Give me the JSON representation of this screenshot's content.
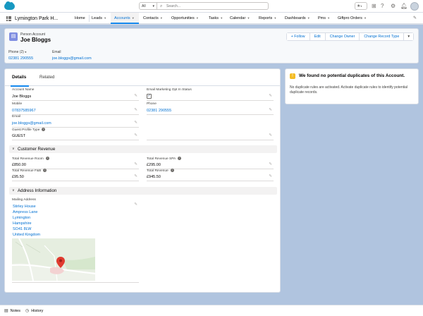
{
  "topbar": {
    "search_scope": "All",
    "search_placeholder": "Search..."
  },
  "nav": {
    "app_name": "Lymington Park H...",
    "items": [
      {
        "label": "Home",
        "dropdown": false
      },
      {
        "label": "Leads",
        "dropdown": true
      },
      {
        "label": "Accounts",
        "dropdown": true,
        "active": true
      },
      {
        "label": "Contacts",
        "dropdown": true
      },
      {
        "label": "Opportunities",
        "dropdown": true
      },
      {
        "label": "Tasks",
        "dropdown": true
      },
      {
        "label": "Calendar",
        "dropdown": true
      },
      {
        "label": "Reports",
        "dropdown": true
      },
      {
        "label": "Dashboards",
        "dropdown": true
      },
      {
        "label": "Pms",
        "dropdown": true
      },
      {
        "label": "Giftpro Orders",
        "dropdown": true
      }
    ]
  },
  "header": {
    "record_type": "Person Account",
    "record_name": "Joe Bloggs",
    "buttons": [
      "+ Follow",
      "Edit",
      "Change Owner",
      "Change Record Type"
    ],
    "highlights": [
      {
        "label": "Phone (2)",
        "value": "02381 290555"
      },
      {
        "label": "Email",
        "value": "joe.bloggs@gmail.com"
      }
    ]
  },
  "tabs": [
    "Details",
    "Related"
  ],
  "details": {
    "account_name_label": "Account Name",
    "account_name": "Joe Bloggs",
    "email_opt_in_label": "Email Marketing Opt In Status",
    "mobile_label": "Mobile",
    "mobile": "07837585967",
    "phone_label": "Phone",
    "phone": "02381 290555",
    "email_label": "Email",
    "email": "joe.bloggs@gmail.com",
    "guest_profile_type_label": "Guest Profile Type",
    "guest_profile_type": "GUEST"
  },
  "customer_revenue": {
    "title": "Customer Revenue",
    "room_label": "Total Revenue Room",
    "room": "£850.00",
    "spa_label": "Total Revenue SPA",
    "spa": "£295.00",
    "fb_label": "Total Revenue F&B",
    "fb": "£95.50",
    "total_label": "Total Revenue",
    "total": "£945.50"
  },
  "address": {
    "title": "Address Information",
    "mailing_label": "Mailing Address",
    "lines": [
      "Stirley House",
      "Ampress Lane",
      "Lymington",
      "Hampshire",
      "SO41 8LW",
      "United Kingdom"
    ]
  },
  "duplicates": {
    "title": "We found no potential duplicates of this Account.",
    "message": "No duplicate rules are activated. Activate duplicate rules to identify potential duplicate records."
  },
  "footer": {
    "notes": "Notes",
    "history": "History"
  },
  "colors": {
    "accent": "#0070d2",
    "background": "#b0c4df",
    "account_icon": "#7f8de1",
    "warning": "#f4bc25"
  }
}
